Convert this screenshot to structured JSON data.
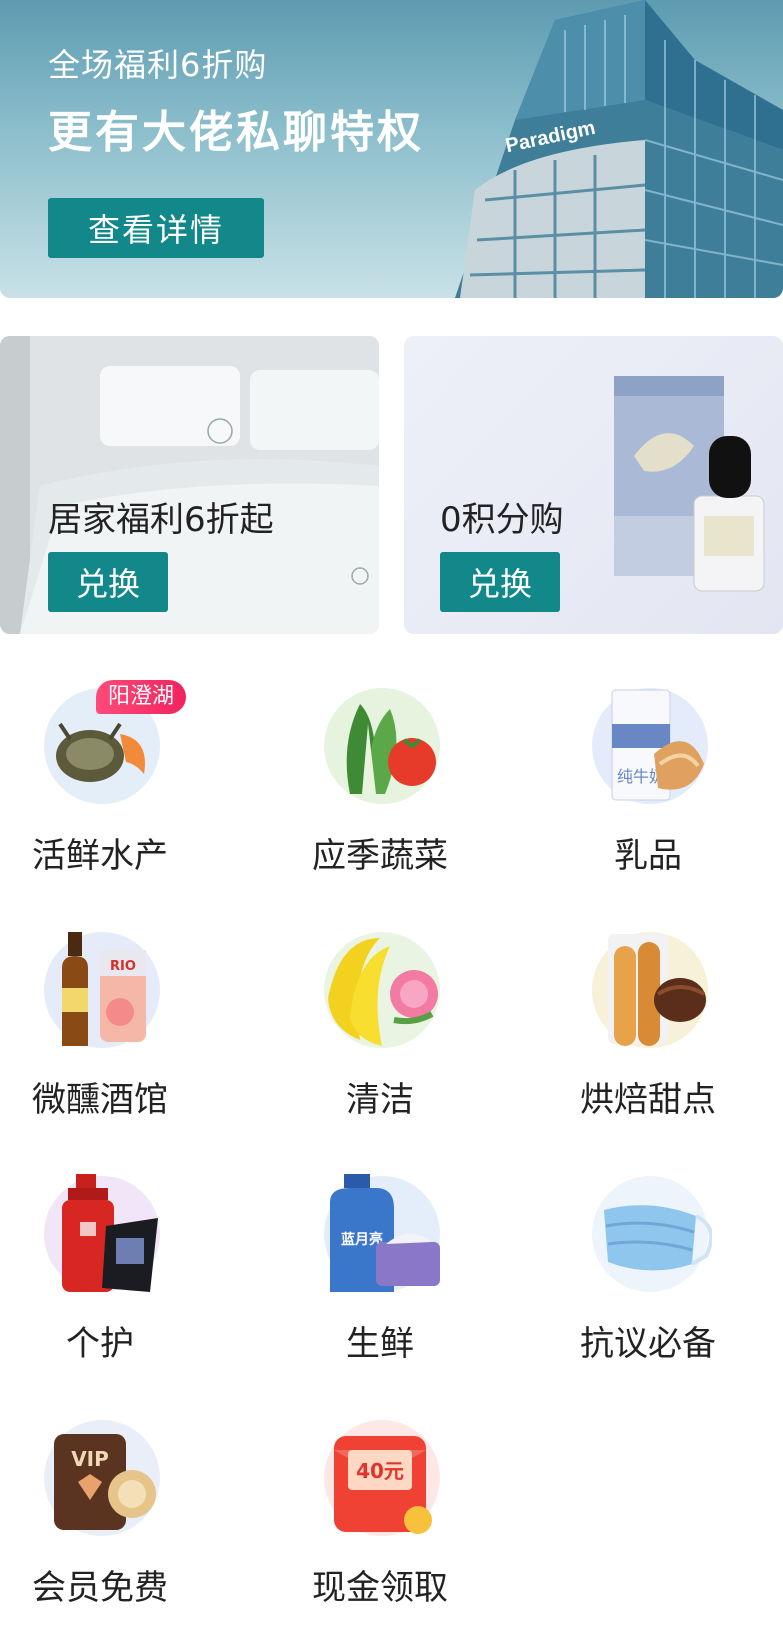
{
  "hero": {
    "line1": "全场福利6折购",
    "line2": "更有大佬私聊特权",
    "button": "查看详情",
    "building_logo": "Paradigm"
  },
  "promos": [
    {
      "title": "居家福利6折起",
      "button": "兑换"
    },
    {
      "title": "0积分购",
      "button": "兑换"
    }
  ],
  "categories": [
    {
      "label": "活鲜水产",
      "icon": "crab-shrimp-icon",
      "badge": "阳澄湖"
    },
    {
      "label": "应季蔬菜",
      "icon": "vegetable-icon"
    },
    {
      "label": "乳品",
      "icon": "milk-bread-icon",
      "text": "纯牛奶"
    },
    {
      "label": "微醺酒馆",
      "icon": "beer-drink-icon",
      "text": "RIO"
    },
    {
      "label": "清洁",
      "icon": "banana-flower-icon"
    },
    {
      "label": "烘焙甜点",
      "icon": "baguette-icon"
    },
    {
      "label": "个护",
      "icon": "shampoo-icon"
    },
    {
      "label": "生鲜",
      "icon": "detergent-icon",
      "text": "蓝月亮"
    },
    {
      "label": "抗议必备",
      "icon": "mask-icon"
    },
    {
      "label": "会员免费",
      "icon": "vip-card-icon",
      "text": "VIP"
    },
    {
      "label": "现金领取",
      "icon": "red-envelope-icon",
      "text": "40元"
    }
  ],
  "colors": {
    "accent": "#12888a",
    "badge": "#f0245f"
  }
}
